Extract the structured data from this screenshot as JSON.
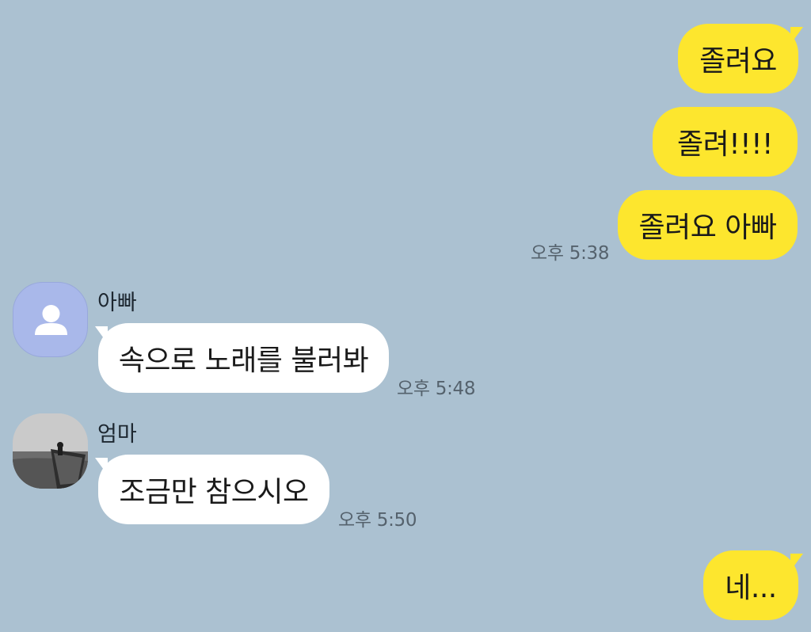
{
  "messages": {
    "m1": {
      "text": "졸려요"
    },
    "m2": {
      "text": "졸려!!!!"
    },
    "m3": {
      "text": "졸려요 아빠",
      "time": "오후 5:38"
    },
    "m4": {
      "sender": "아빠",
      "text": "속으로 노래를 불러봐",
      "time": "오후 5:48"
    },
    "m5": {
      "sender": "엄마",
      "text": "조금만 참으시오",
      "time": "오후 5:50"
    },
    "m6": {
      "text": "네..."
    }
  },
  "icons": {
    "default_avatar": "person-silhouette-icon",
    "mom_avatar": "seaside-photo-avatar"
  },
  "colors": {
    "background": "#abc1d1",
    "my_bubble": "#fde62e",
    "their_bubble": "#ffffff",
    "default_avatar": "#a9b8ea"
  }
}
